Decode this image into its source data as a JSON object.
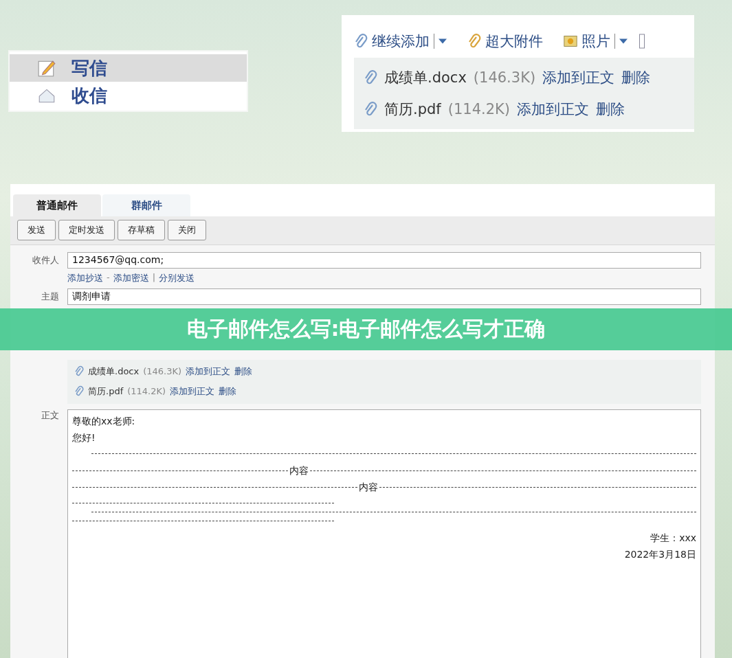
{
  "nav_panel": {
    "items": [
      {
        "label": "写信",
        "selected": true
      },
      {
        "label": "收信",
        "selected": false
      }
    ]
  },
  "attach_panel": {
    "toolbar": [
      {
        "label": "继续添加",
        "kind": "attach",
        "dropdown": true
      },
      {
        "label": "超大附件",
        "kind": "large",
        "dropdown": false
      },
      {
        "label": "照片",
        "kind": "photo",
        "dropdown": true
      }
    ],
    "attachments": [
      {
        "name": "成绩单.docx",
        "size": "(146.3K)",
        "insert": "添加到正文",
        "delete": "删除"
      },
      {
        "name": "简历.pdf",
        "size": "(114.2K)",
        "insert": "添加到正文",
        "delete": "删除"
      }
    ]
  },
  "compose": {
    "tabs": [
      {
        "label": "普通邮件",
        "selected": true
      },
      {
        "label": "群邮件",
        "selected": false
      }
    ],
    "buttons": [
      "发送",
      "定时发送",
      "存草稿",
      "关闭"
    ],
    "to": {
      "label": "收件人",
      "value": "1234567@qq.com;"
    },
    "to_links": [
      "添加抄送",
      "-",
      "添加密送",
      "|",
      "分别发送"
    ],
    "subject": {
      "label": "主题",
      "value": "调剂申请"
    },
    "attachments": [
      {
        "name": "成绩单.docx",
        "size": "(146.3K)",
        "insert": "添加到正文",
        "delete": "删除"
      },
      {
        "name": "简历.pdf",
        "size": "(114.2K)",
        "insert": "添加到正文",
        "delete": "删除"
      }
    ],
    "body_label": "正文",
    "body": [
      {
        "kind": "text",
        "text": "尊敬的xx老师:"
      },
      {
        "kind": "text",
        "text": "您好!"
      },
      {
        "kind": "dashes"
      },
      {
        "kind": "labelled",
        "text": "内容"
      },
      {
        "kind": "labelled",
        "text": "内容"
      },
      {
        "kind": "short_dashes"
      },
      {
        "kind": "dashes"
      },
      {
        "kind": "short_dashes"
      },
      {
        "kind": "right",
        "text": "学生：xxx"
      },
      {
        "kind": "right",
        "text": "2022年3月18日"
      }
    ]
  },
  "banner": {
    "title": "电子邮件怎么写:电子邮件怎么写才正确"
  }
}
